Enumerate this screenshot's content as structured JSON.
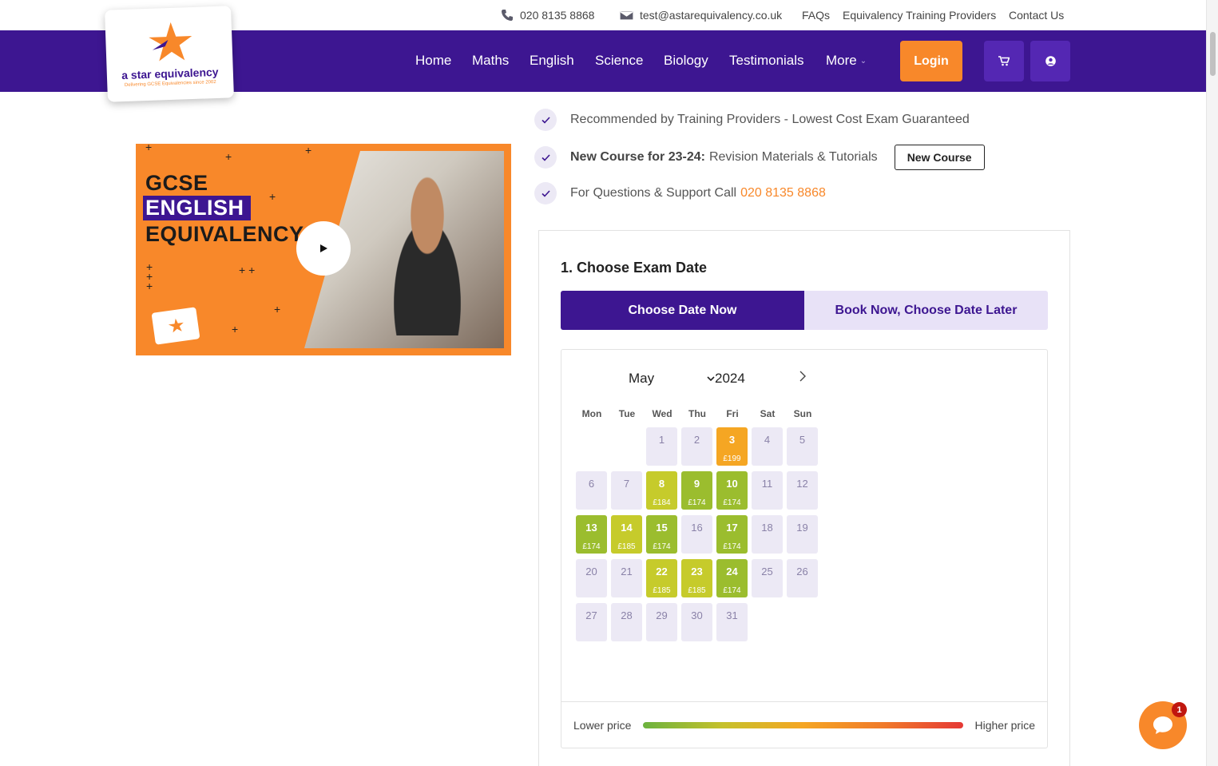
{
  "topbar": {
    "phone": "020 8135 8868",
    "email": "test@astarequivalency.co.uk",
    "links": [
      "FAQs",
      "Equivalency Training Providers",
      "Contact Us"
    ]
  },
  "logo": {
    "brand": "a star equivalency",
    "tagline": "Delivering GCSE Equivalencies since 2002"
  },
  "nav": {
    "items": [
      "Home",
      "Maths",
      "English",
      "Science",
      "Biology",
      "Testimonials"
    ],
    "more": "More",
    "login": "Login"
  },
  "features": {
    "item1": "Recommended by Training Providers - Lowest Cost Exam Guaranteed",
    "item2_bold": "New Course for 23-24:",
    "item2_text": "Revision Materials & Tutorials",
    "item2_button": "New Course",
    "item3_text": "For Questions & Support Call",
    "item3_phone": "020 8135 8868"
  },
  "video": {
    "line1": "GCSE",
    "line2": "ENGLISH",
    "line3": "EQUIVALENCY"
  },
  "booking": {
    "title": "1. Choose Exam Date",
    "tab_now": "Choose Date Now",
    "tab_later": "Book Now, Choose Date Later",
    "month": "May",
    "year": "2024",
    "weekdays": [
      "Mon",
      "Tue",
      "Wed",
      "Thu",
      "Fri",
      "Sat",
      "Sun"
    ],
    "legend_low": "Lower price",
    "legend_high": "Higher price"
  },
  "calendar_days": [
    {
      "d": "1"
    },
    {
      "d": "2"
    },
    {
      "d": "3",
      "price": "£199",
      "color": "#f5a623"
    },
    {
      "d": "4"
    },
    {
      "d": "5"
    },
    {
      "d": "6"
    },
    {
      "d": "7"
    },
    {
      "d": "8",
      "price": "£184",
      "color": "#c6cb2b"
    },
    {
      "d": "9",
      "price": "£174",
      "color": "#9bbd2e"
    },
    {
      "d": "10",
      "price": "£174",
      "color": "#9bbd2e"
    },
    {
      "d": "11"
    },
    {
      "d": "12"
    },
    {
      "d": "13",
      "price": "£174",
      "color": "#9bbd2e"
    },
    {
      "d": "14",
      "price": "£185",
      "color": "#c6cb2b"
    },
    {
      "d": "15",
      "price": "£174",
      "color": "#9bbd2e"
    },
    {
      "d": "16"
    },
    {
      "d": "17",
      "price": "£174",
      "color": "#9bbd2e"
    },
    {
      "d": "18"
    },
    {
      "d": "19"
    },
    {
      "d": "20"
    },
    {
      "d": "21"
    },
    {
      "d": "22",
      "price": "£185",
      "color": "#c6cb2b"
    },
    {
      "d": "23",
      "price": "£185",
      "color": "#c6cb2b"
    },
    {
      "d": "24",
      "price": "£174",
      "color": "#9bbd2e"
    },
    {
      "d": "25"
    },
    {
      "d": "26"
    },
    {
      "d": "27"
    },
    {
      "d": "28"
    },
    {
      "d": "29"
    },
    {
      "d": "30"
    },
    {
      "d": "31"
    }
  ],
  "chat": {
    "badge": "1"
  },
  "colors": {
    "brand_purple": "#3d1691",
    "accent_orange": "#f8882a"
  }
}
